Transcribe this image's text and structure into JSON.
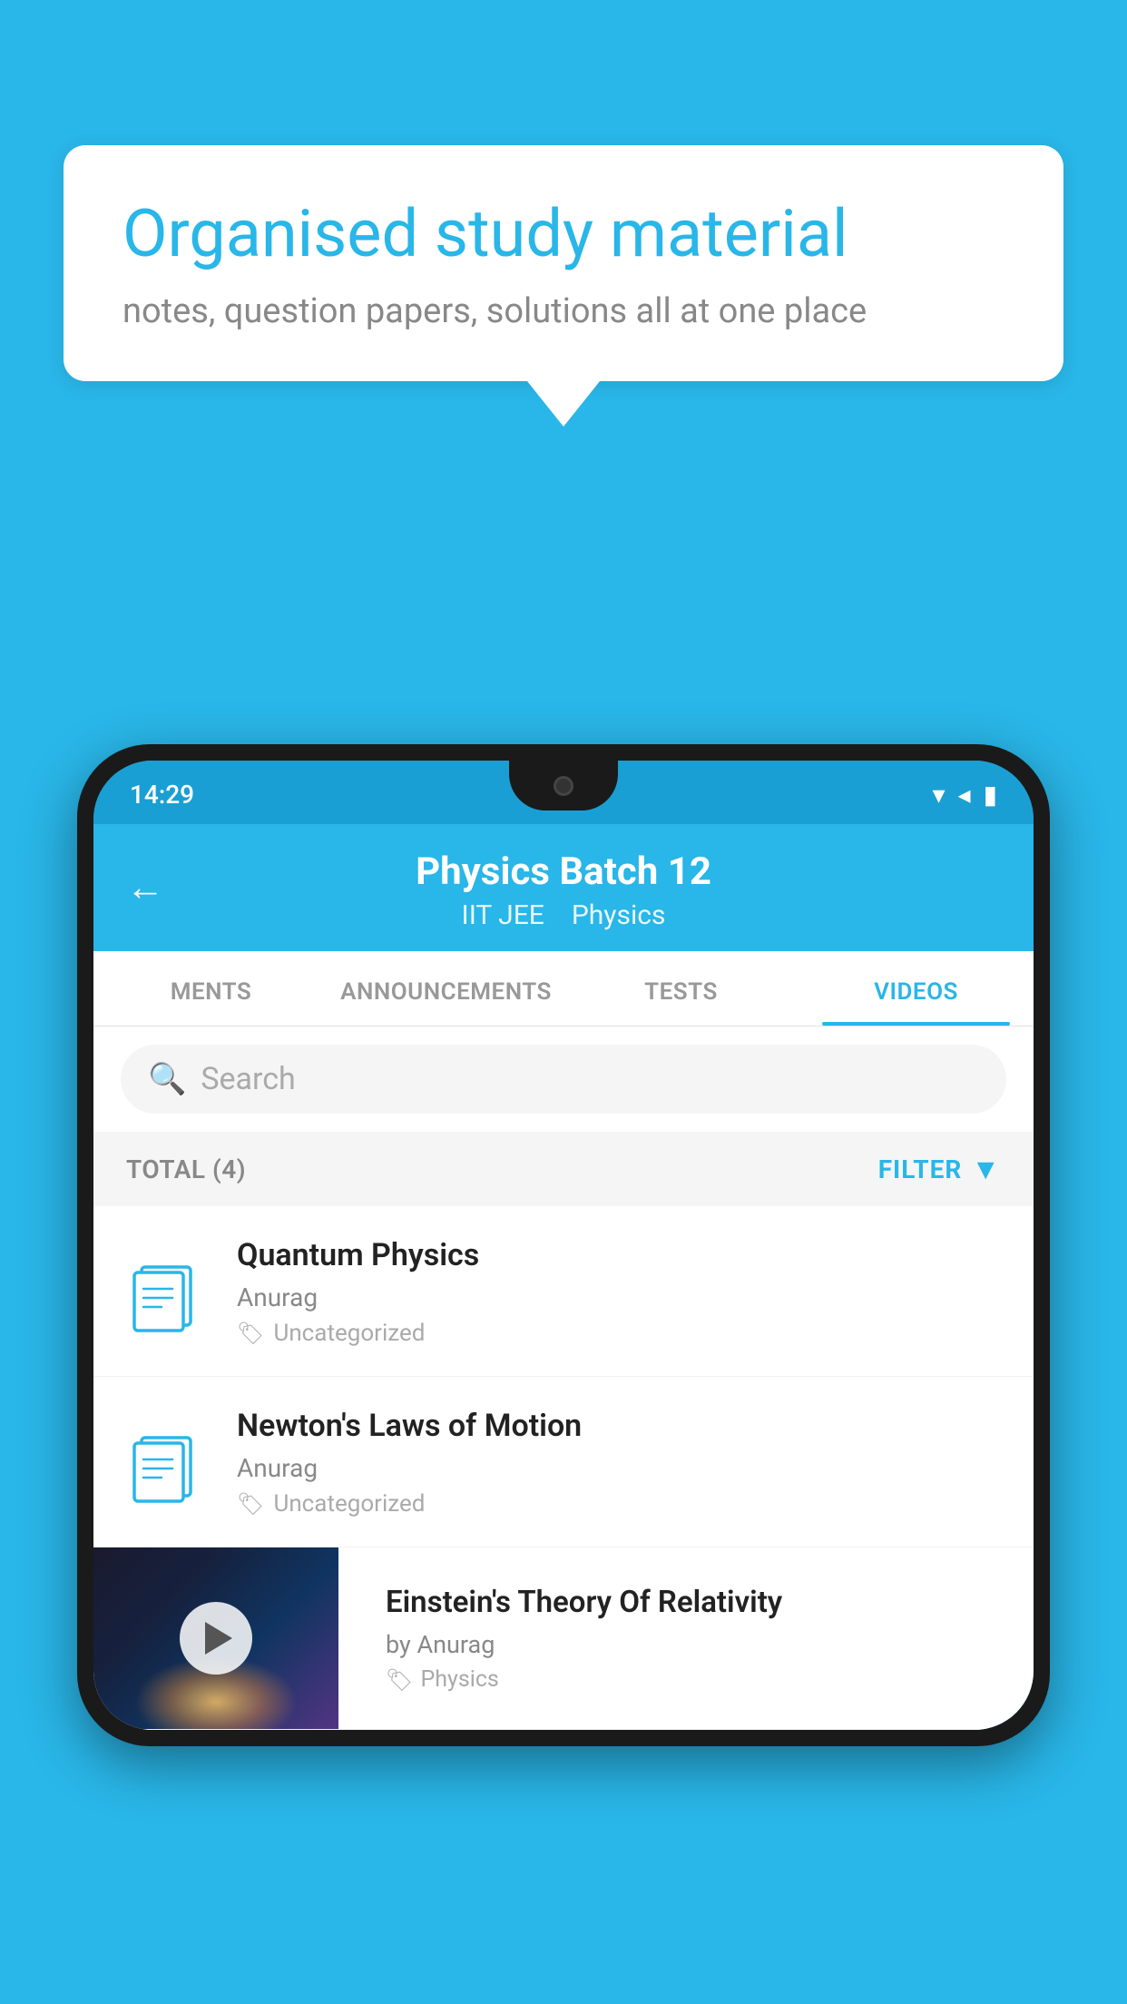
{
  "background": {
    "color": "#29b6e8"
  },
  "speech_bubble": {
    "title": "Organised study material",
    "subtitle": "notes, question papers, solutions all at one place"
  },
  "phone": {
    "status_bar": {
      "time": "14:29"
    },
    "header": {
      "title": "Physics Batch 12",
      "subtitle_left": "IIT JEE",
      "subtitle_right": "Physics"
    },
    "tabs": [
      {
        "label": "MENTS",
        "active": false
      },
      {
        "label": "ANNOUNCEMENTS",
        "active": false
      },
      {
        "label": "TESTS",
        "active": false
      },
      {
        "label": "VIDEOS",
        "active": true
      }
    ],
    "search": {
      "placeholder": "Search"
    },
    "filter": {
      "total_label": "TOTAL (4)",
      "filter_label": "FILTER"
    },
    "videos": [
      {
        "id": 1,
        "title": "Quantum Physics",
        "author": "Anurag",
        "tag": "Uncategorized",
        "type": "folder"
      },
      {
        "id": 2,
        "title": "Newton's Laws of Motion",
        "author": "Anurag",
        "tag": "Uncategorized",
        "type": "folder"
      },
      {
        "id": 3,
        "title": "Einstein's Theory Of Relativity",
        "author": "by Anurag",
        "tag": "Physics",
        "type": "video"
      }
    ]
  }
}
